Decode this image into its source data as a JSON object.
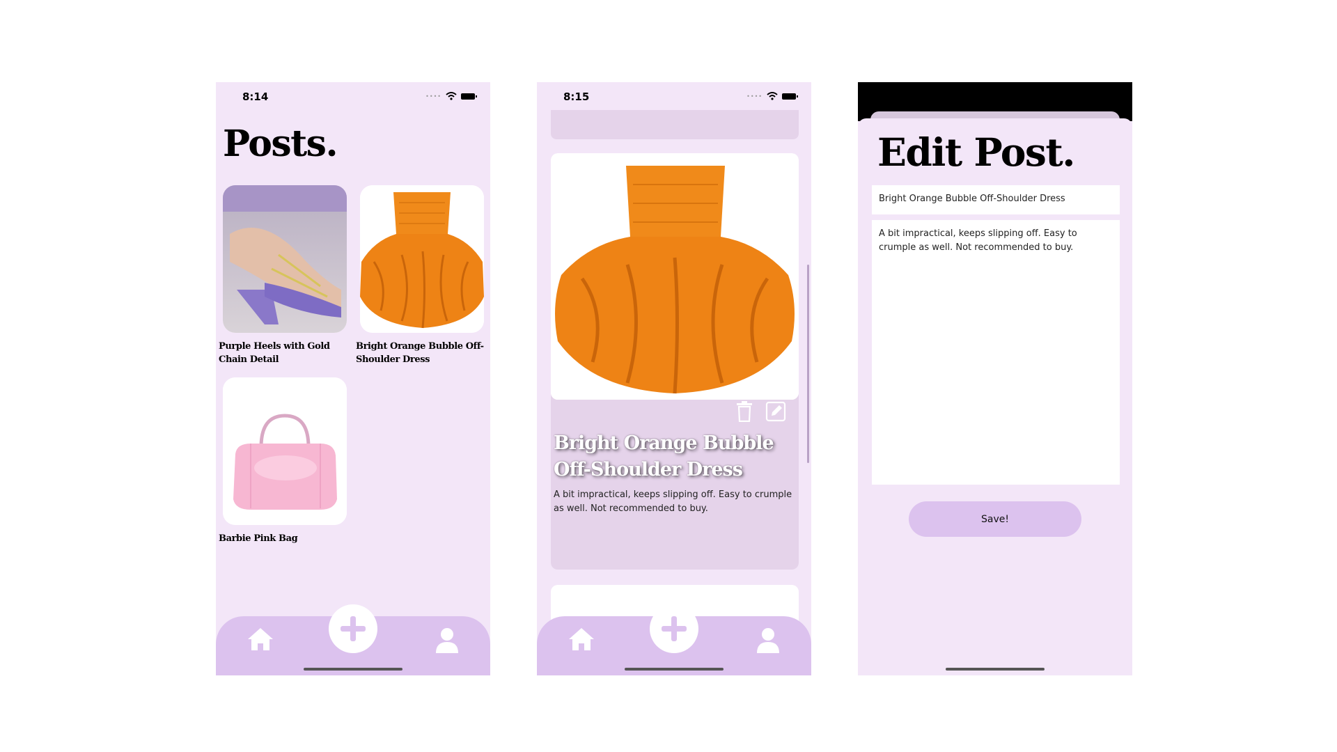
{
  "screens": [
    {
      "status_time": "8:14",
      "title": "Posts.",
      "posts": [
        {
          "caption": "Purple Heels with Gold Chain Detail"
        },
        {
          "caption": "Bright Orange Bubble Off-Shoulder Dress"
        },
        {
          "caption": "Barbie Pink Bag"
        }
      ]
    },
    {
      "status_time": "8:15",
      "post": {
        "title": "Bright Orange Bubble Off-Shoulder Dress",
        "description": "A bit impractical, keeps slipping off. Easy to crumple as well. Not recommended to buy."
      }
    },
    {
      "title": "Edit Post.",
      "title_field_value": "Bright Orange Bubble Off-Shoulder Dress",
      "description_field_value": "A bit impractical, keeps slipping off. Easy to crumple as well. Not recommended to buy.",
      "save_label": "Save!"
    }
  ],
  "tabbar": {
    "icons": [
      "home-icon",
      "plus-icon",
      "user-icon"
    ]
  },
  "colors": {
    "background": "#f3e6f8",
    "tabbar": "#dcc2ee",
    "card": "#e5d3ea",
    "accent_orange": "#f08a1a"
  }
}
